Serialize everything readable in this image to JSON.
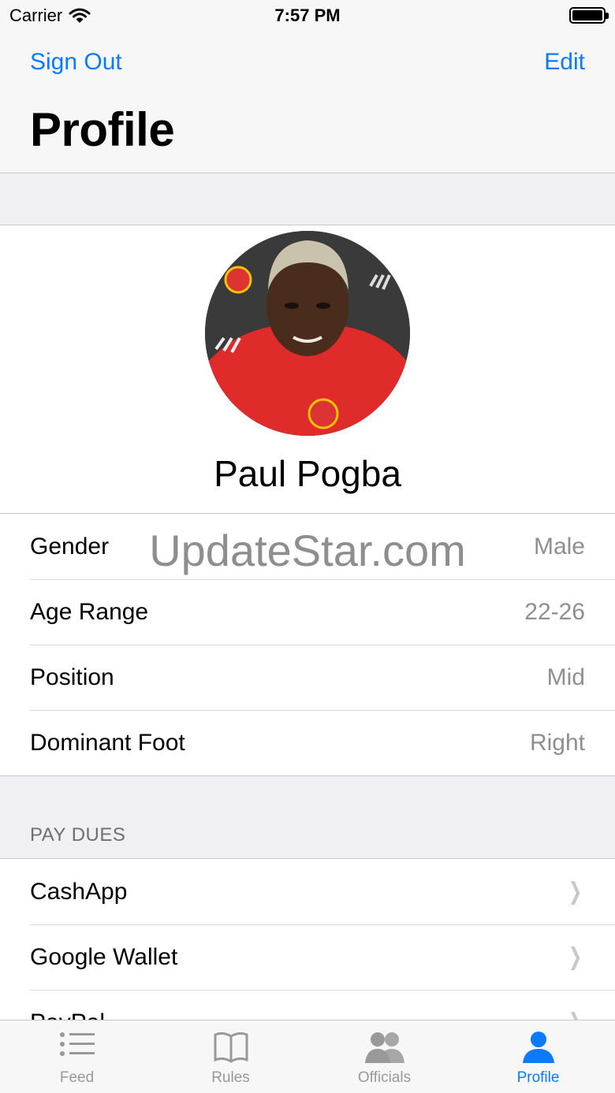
{
  "status_bar": {
    "carrier": "Carrier",
    "time": "7:57 PM"
  },
  "nav": {
    "left_label": "Sign Out",
    "right_label": "Edit",
    "title": "Profile"
  },
  "profile": {
    "name": "Paul Pogba"
  },
  "info_rows": [
    {
      "label": "Gender",
      "value": "Male"
    },
    {
      "label": "Age Range",
      "value": "22-26"
    },
    {
      "label": "Position",
      "value": "Mid"
    },
    {
      "label": "Dominant Foot",
      "value": "Right"
    }
  ],
  "watermark": "UpdateStar.com",
  "pay_dues": {
    "header": "PAY DUES",
    "items": [
      {
        "label": "CashApp"
      },
      {
        "label": "Google Wallet"
      },
      {
        "label": "PayPal"
      }
    ]
  },
  "tabs": [
    {
      "label": "Feed",
      "icon": "list-icon",
      "active": false
    },
    {
      "label": "Rules",
      "icon": "book-icon",
      "active": false
    },
    {
      "label": "Officials",
      "icon": "people-icon",
      "active": false
    },
    {
      "label": "Profile",
      "icon": "person-icon",
      "active": true
    }
  ],
  "colors": {
    "tint": "#0a7bff",
    "inactive": "#999999",
    "secondary_text": "#8e8e93"
  }
}
